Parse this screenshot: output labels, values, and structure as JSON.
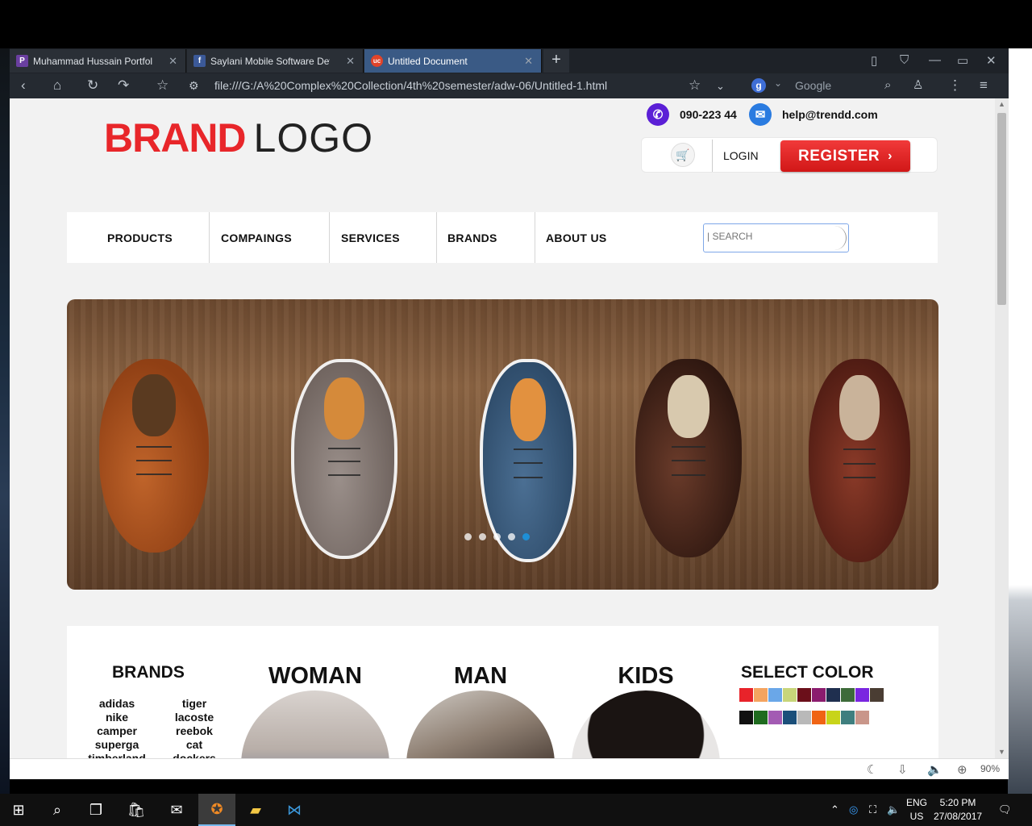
{
  "browser": {
    "tabs": [
      {
        "label": "Muhammad Hussain Portfolio",
        "favicon": "P",
        "favicon_color": "#6a3fa0"
      },
      {
        "label": "Saylani Mobile Software Dev",
        "favicon": "f",
        "favicon_color": "#3b5998"
      },
      {
        "label": "Untitled Document",
        "favicon": "uc",
        "favicon_color": "#e0442a"
      }
    ],
    "url": "file:///G:/A%20Complex%20Collection/4th%20semester/adw-06/Untitled-1.html",
    "search_placeholder": "Google",
    "search_engine_icon": "g",
    "zoom": "90%"
  },
  "header": {
    "logo_brand": "BRAND",
    "logo_word": "LOGO",
    "phone": "090-223 44",
    "email": "help@trendd.com",
    "login_label": "LOGIN",
    "register_label": "REGISTER",
    "accent": "#e8262a",
    "phone_icon_color": "#5b1fd6",
    "mail_icon_color": "#2a7be0"
  },
  "nav": {
    "items": [
      "PRODUCTS",
      "COMPAINGS",
      "SERVICES",
      "BRANDS",
      "ABOUT US"
    ],
    "search_placeholder": "| SEARCH"
  },
  "slider": {
    "dots": 5,
    "active_dot": 5,
    "active_dot_color": "#1e8fd6"
  },
  "categories": {
    "brands_heading": "BRANDS",
    "brands_left": [
      "adidas",
      "nike",
      "camper",
      "superga",
      "timberland"
    ],
    "brands_right": [
      "tiger",
      "lacoste",
      "reebok",
      "cat",
      "dockers"
    ],
    "sections": [
      "WOMAN",
      "MAN",
      "KIDS"
    ],
    "select_color_heading": "SELECT COLOR",
    "swatch_row1": [
      "#e8232a",
      "#f4a460",
      "#6aa7e8",
      "#c8d57a",
      "#6b0f1a",
      "#8b1c6e",
      "#1f2f4f",
      "#3d6b3a",
      "#7a26e0",
      "#4a3d33"
    ],
    "swatch_row2": [
      "#111111",
      "#1f6b1f",
      "#a35bb3",
      "#1b4f7a",
      "#b9b9b9",
      "#f06414",
      "#c8d41a",
      "#3f7f7f",
      "#c9968a"
    ]
  },
  "taskbar": {
    "language": "ENG",
    "region": "US",
    "time": "5:20 PM",
    "date": "27/08/2017"
  }
}
